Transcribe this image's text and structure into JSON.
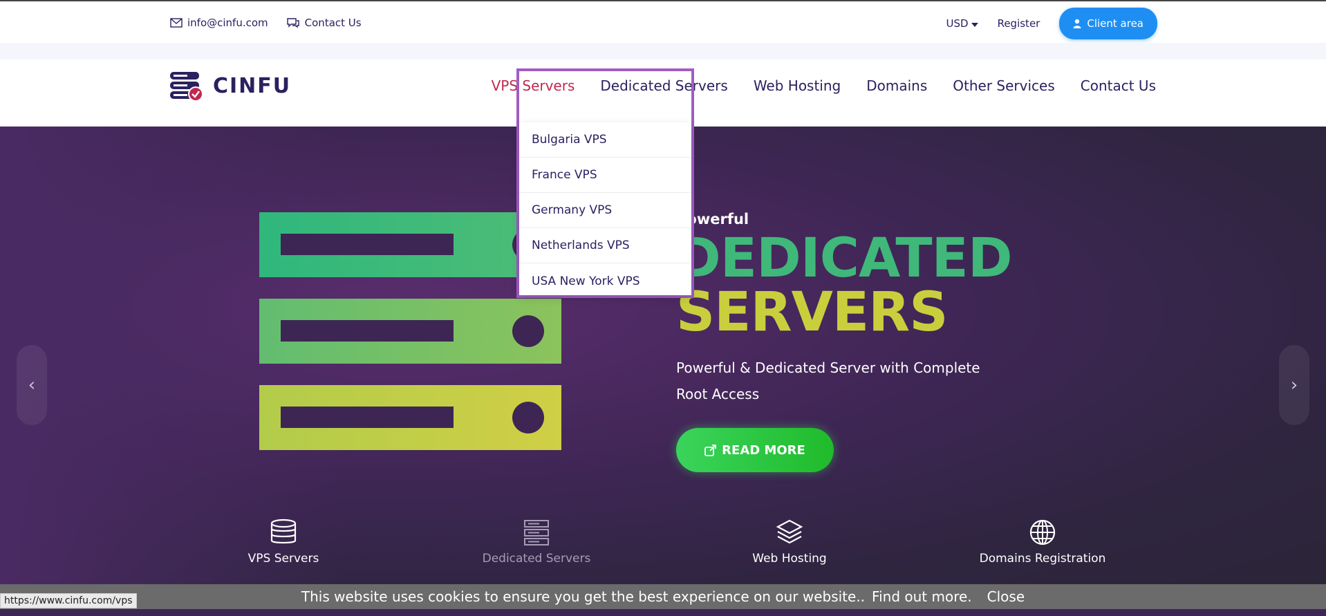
{
  "topbar": {
    "email": "info@cinfu.com",
    "contact": "Contact Us",
    "currency": "USD",
    "register": "Register",
    "client_area": "Client area"
  },
  "logo": {
    "name": "CINFU"
  },
  "nav": {
    "items": [
      "VPS Servers",
      "Dedicated Servers",
      "Web Hosting",
      "Domains",
      "Other Services",
      "Contact Us"
    ]
  },
  "dropdown": {
    "items": [
      "Bulgaria VPS",
      "France VPS",
      "Germany VPS",
      "Netherlands VPS",
      "USA New York VPS"
    ]
  },
  "hero": {
    "eyebrow": "Powerful",
    "headline1": "DEDICATED",
    "headline2": "SERVERS",
    "description": "Powerful & Dedicated Server with Complete Root Access",
    "cta": "READ MORE",
    "prev_arrow": "‹",
    "next_arrow": "›"
  },
  "features": [
    "VPS Servers",
    "Dedicated Servers",
    "Web Hosting",
    "Domains Registration"
  ],
  "cookie": {
    "message": "This website uses cookies to ensure you get the best experience on our website..",
    "find_out": "Find out more.",
    "close": "Close"
  },
  "status_url": "https://www.cinfu.com/vps",
  "colors": {
    "brand": "#2a2160",
    "accent_red": "#c0284f",
    "client_btn": "#1e8ef2",
    "cta_green": "#2cc841",
    "headline_green": "#3fb87a",
    "headline_yellow": "#c9cf3c",
    "dropdown_outline": "#a05cc4"
  }
}
